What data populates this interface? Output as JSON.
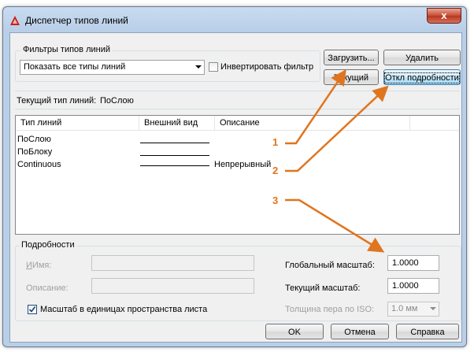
{
  "window": {
    "title": "Диспетчер типов линий",
    "close_glyph": "x"
  },
  "filters": {
    "group_label": "Фильтры типов линий",
    "selected": "Показать все типы линий",
    "invert_label": "Инвертировать фильтр",
    "invert_checked": false
  },
  "buttons": {
    "load": "Загрузить...",
    "delete": "Удалить",
    "current": "Текущий",
    "details": "Откл подробности",
    "ok": "OK",
    "cancel": "Отмена",
    "help": "Справка"
  },
  "current_linetype": {
    "label": "Текущий тип линий:",
    "value": "ПоСлою"
  },
  "table": {
    "columns": [
      "Тип линий",
      "Внешний вид",
      "Описание"
    ],
    "rows": [
      {
        "name": "ПоСлою",
        "description": ""
      },
      {
        "name": "ПоБлоку",
        "description": ""
      },
      {
        "name": "Continuous",
        "description": "Непрерывный"
      }
    ]
  },
  "details": {
    "group_label": "Подробности",
    "name_label": "Имя:",
    "name_value": "",
    "description_label": "Описание:",
    "description_value": "",
    "paper_space_label": "Масштаб в единицах пространства листа",
    "paper_space_checked": true,
    "global_scale_label": "Глобальный масштаб:",
    "global_scale_value": "1.0000",
    "current_scale_label": "Текущий масштаб:",
    "current_scale_value": "1.0000",
    "pen_width_label": "Толщина пера по ISO:",
    "pen_width_value": "1.0 мм"
  },
  "callouts": [
    "1",
    "2",
    "3"
  ],
  "colors": {
    "accent": "#e0751f",
    "title_bar": "#b9cfe8",
    "close": "#c74b32"
  }
}
